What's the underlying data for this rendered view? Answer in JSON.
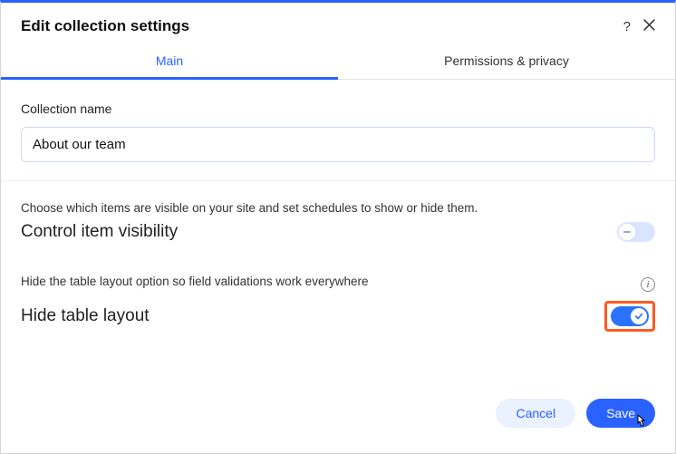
{
  "header": {
    "title": "Edit collection settings"
  },
  "tabs": {
    "main": "Main",
    "permissions": "Permissions & privacy"
  },
  "name_field": {
    "label": "Collection name",
    "value": "About our team"
  },
  "visibility": {
    "helper": "Choose which items are visible on your site and set schedules to show or hide them.",
    "title": "Control item visibility",
    "toggle_on": false
  },
  "hide_layout": {
    "helper": "Hide the table layout option so field validations work everywhere",
    "title": "Hide table layout",
    "toggle_on": true
  },
  "footer": {
    "cancel": "Cancel",
    "save": "Save"
  }
}
